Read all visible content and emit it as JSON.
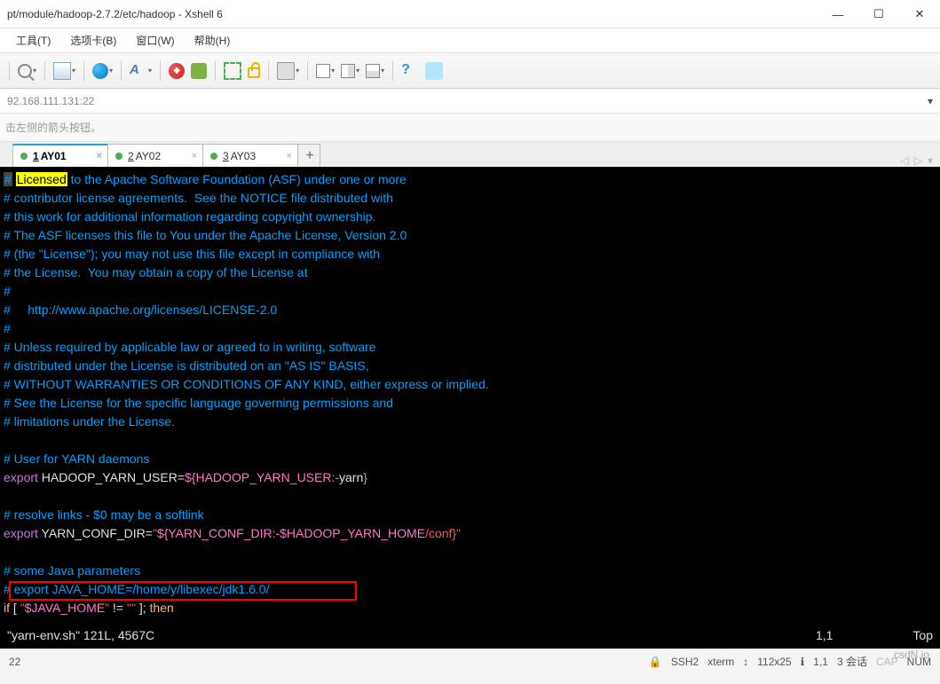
{
  "window": {
    "title": "pt/module/hadoop-2.7.2/etc/hadoop - Xshell 6",
    "minimize": "—",
    "maximize": "☐",
    "close": "✕"
  },
  "menubar": {
    "tools": "工具(T)",
    "options": "选项卡(B)",
    "window": "窗口(W)",
    "help": "帮助(H)"
  },
  "address": "92.168.111.131:22",
  "hint": "击左侧的箭头按钮。",
  "tabs": {
    "items": [
      {
        "num": "1",
        "label": "AY01",
        "active": true
      },
      {
        "num": "2",
        "label": "AY02",
        "active": false
      },
      {
        "num": "3",
        "label": "AY03",
        "active": false
      }
    ],
    "add": "+"
  },
  "terminal": {
    "lines": [
      {
        "t": "comment",
        "text": "# Licensed to the Apache Software Foundation (ASF) under one or more",
        "hl_word": "Licensed",
        "cursor": true
      },
      {
        "t": "comment",
        "text": "# contributor license agreements.  See the NOTICE file distributed with"
      },
      {
        "t": "comment",
        "text": "# this work for additional information regarding copyright ownership."
      },
      {
        "t": "comment",
        "text": "# The ASF licenses this file to You under the Apache License, Version 2.0"
      },
      {
        "t": "comment",
        "text": "# (the \"License\"); you may not use this file except in compliance with"
      },
      {
        "t": "comment",
        "text": "# the License.  You may obtain a copy of the License at"
      },
      {
        "t": "comment",
        "text": "#"
      },
      {
        "t": "comment",
        "text": "#     http://www.apache.org/licenses/LICENSE-2.0"
      },
      {
        "t": "comment",
        "text": "#"
      },
      {
        "t": "comment",
        "text": "# Unless required by applicable law or agreed to in writing, software"
      },
      {
        "t": "comment",
        "text": "# distributed under the License is distributed on an \"AS IS\" BASIS,"
      },
      {
        "t": "comment",
        "text": "# WITHOUT WARRANTIES OR CONDITIONS OF ANY KIND, either express or implied."
      },
      {
        "t": "comment",
        "text": "# See the License for the specific language governing permissions and"
      },
      {
        "t": "comment",
        "text": "# limitations under the License."
      },
      {
        "t": "blank",
        "text": ""
      },
      {
        "t": "comment",
        "text": "# User for YARN daemons"
      },
      {
        "t": "export1",
        "text": "export HADOOP_YARN_USER=${HADOOP_YARN_USER:-yarn}"
      },
      {
        "t": "blank",
        "text": ""
      },
      {
        "t": "comment",
        "text": "# resolve links - $0 may be a softlink"
      },
      {
        "t": "export2",
        "text": "export YARN_CONF_DIR=\"${YARN_CONF_DIR:-$HADOOP_YARN_HOME/conf}\""
      },
      {
        "t": "blank",
        "text": ""
      },
      {
        "t": "comment",
        "text": "# some Java parameters"
      },
      {
        "t": "comment",
        "text": "# export JAVA_HOME=/home/y/libexec/jdk1.6.0/"
      },
      {
        "t": "ifline",
        "text": "if [ \"$JAVA_HOME\" != \"\" ]; then"
      }
    ],
    "status_left": "\"yarn-env.sh\" 121L, 4567C",
    "status_pos": "1,1",
    "status_right": "Top"
  },
  "footer": {
    "left": "22",
    "ssh": "SSH2",
    "term": "xterm",
    "size": "112x25",
    "pos": "1,1",
    "sess": "3 会话",
    "cap": "CAP",
    "num": "NUM"
  },
  "watermark": "csdN.io"
}
